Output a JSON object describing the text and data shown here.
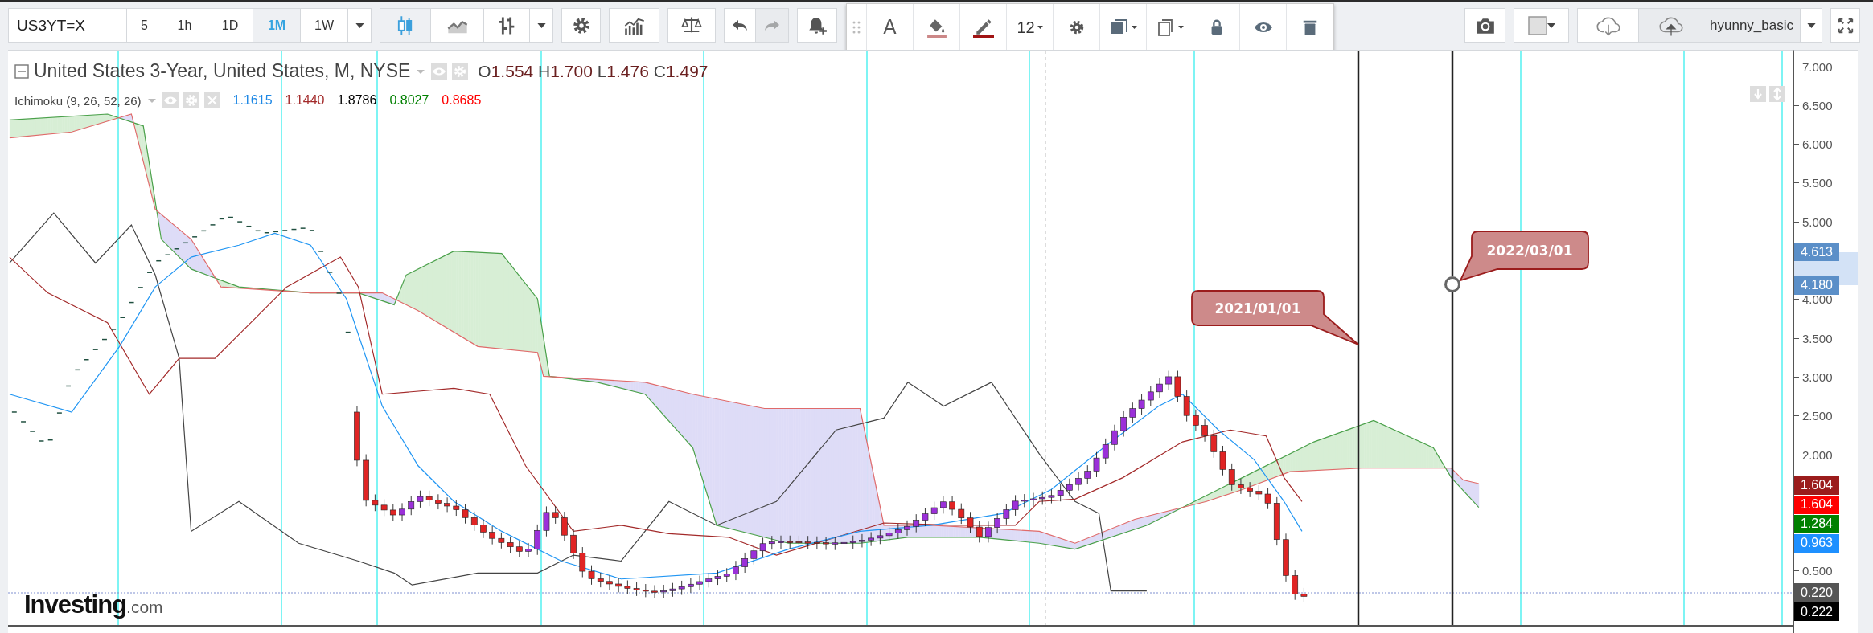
{
  "symbol": {
    "value": "US3YT=X"
  },
  "intervals": [
    {
      "label": "5",
      "selected": false
    },
    {
      "label": "1h",
      "selected": false
    },
    {
      "label": "1D",
      "selected": false
    },
    {
      "label": "1M",
      "selected": true
    },
    {
      "label": "1W",
      "selected": false
    }
  ],
  "chart_types": [
    {
      "kind": "candles",
      "selected": true
    },
    {
      "kind": "line",
      "selected": false
    },
    {
      "kind": "bars",
      "selected": false
    }
  ],
  "history": [
    {
      "kind": "undo",
      "disabled": false
    },
    {
      "kind": "redo",
      "disabled": true
    }
  ],
  "drawing_toolbar": {
    "text_tool": "A",
    "font_size": "12"
  },
  "template": {
    "name": "hyunny_basic"
  },
  "legend": {
    "title": "United States 3-Year, United States, M, NYSE",
    "ohlc": [
      {
        "label": "O",
        "value": "1.554"
      },
      {
        "label": "H",
        "value": "1.700"
      },
      {
        "label": "L",
        "value": "1.476"
      },
      {
        "label": "C",
        "value": "1.497"
      }
    ]
  },
  "indicator": {
    "name": "Ichimoku (9, 26, 52, 26)",
    "values": [
      {
        "text": "1.1615",
        "color": "#1e88e5"
      },
      {
        "text": "1.1440",
        "color": "#a32a2a"
      },
      {
        "text": "1.8786",
        "color": "#000000"
      },
      {
        "text": "0.8027",
        "color": "#008000"
      },
      {
        "text": "0.8685",
        "color": "#ff0000"
      }
    ]
  },
  "drawings": [
    {
      "kind": "callout",
      "text": "2021/01/01"
    },
    {
      "kind": "callout",
      "text": "2022/03/01"
    }
  ],
  "price_axis": {
    "ticks": [
      "7.000",
      "6.500",
      "6.000",
      "5.500",
      "5.000",
      "4.000",
      "3.500",
      "3.000",
      "2.500",
      "2.000",
      "0.500"
    ]
  },
  "price_tags": [
    {
      "kind": "range",
      "text": "4.613",
      "color": "#5b8fc8"
    },
    {
      "kind": "range",
      "text": "4.180",
      "color": "#5b8fc8"
    },
    {
      "kind": "last",
      "text": "1.604",
      "color": "#9b1c1c"
    },
    {
      "kind": "last",
      "text": "1.604",
      "color": "#ff0000"
    },
    {
      "kind": "last",
      "text": "1.284",
      "color": "#008000"
    },
    {
      "kind": "last",
      "text": "0.963",
      "color": "#1e90ff"
    },
    {
      "kind": "last",
      "text": "0.220",
      "color": "#555555"
    },
    {
      "kind": "last",
      "text": "0.222",
      "color": "#000000"
    }
  ],
  "logo": {
    "name": "Investing",
    "suffix": ".com"
  }
}
